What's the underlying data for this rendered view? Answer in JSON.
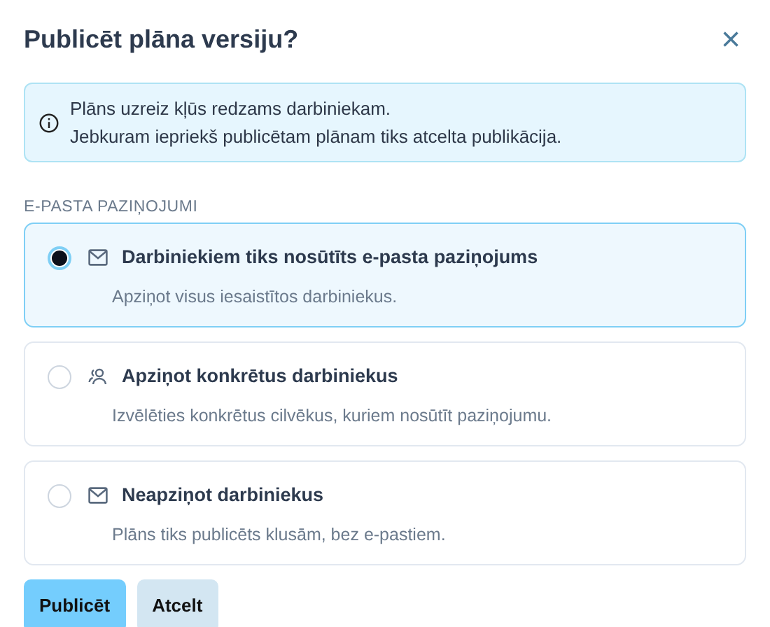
{
  "dialog": {
    "title": "Publicēt plāna versiju?",
    "close": "×"
  },
  "alert": {
    "lines": [
      "Plāns uzreiz kļūs redzams darbiniekam.",
      "Jebkuram iepriekš publicētam plānam tiks atcelta publikācija."
    ]
  },
  "section_label": "E-PASTA PAZIŅOJUMI",
  "options": [
    {
      "kind": "mail",
      "title": "Darbiniekiem tiks nosūtīts e-pasta paziņojums",
      "description": "Apziņot visus iesaistītos darbiniekus.",
      "selected": true
    },
    {
      "kind": "people",
      "title": "Apziņot konkrētus darbiniekus",
      "description": "Izvēlēties konkrētus cilvēkus, kuriem nosūtīt paziņojumu.",
      "selected": false
    },
    {
      "kind": "mail",
      "title": "Neapziņot darbiniekus",
      "description": "Plāns tiks publicēts klusām, bez e-pastiem.",
      "selected": false
    }
  ],
  "buttons": [
    {
      "kind": "primary",
      "label": "Publicēt"
    },
    {
      "kind": "secondary",
      "label": "Atcelt"
    }
  ]
}
